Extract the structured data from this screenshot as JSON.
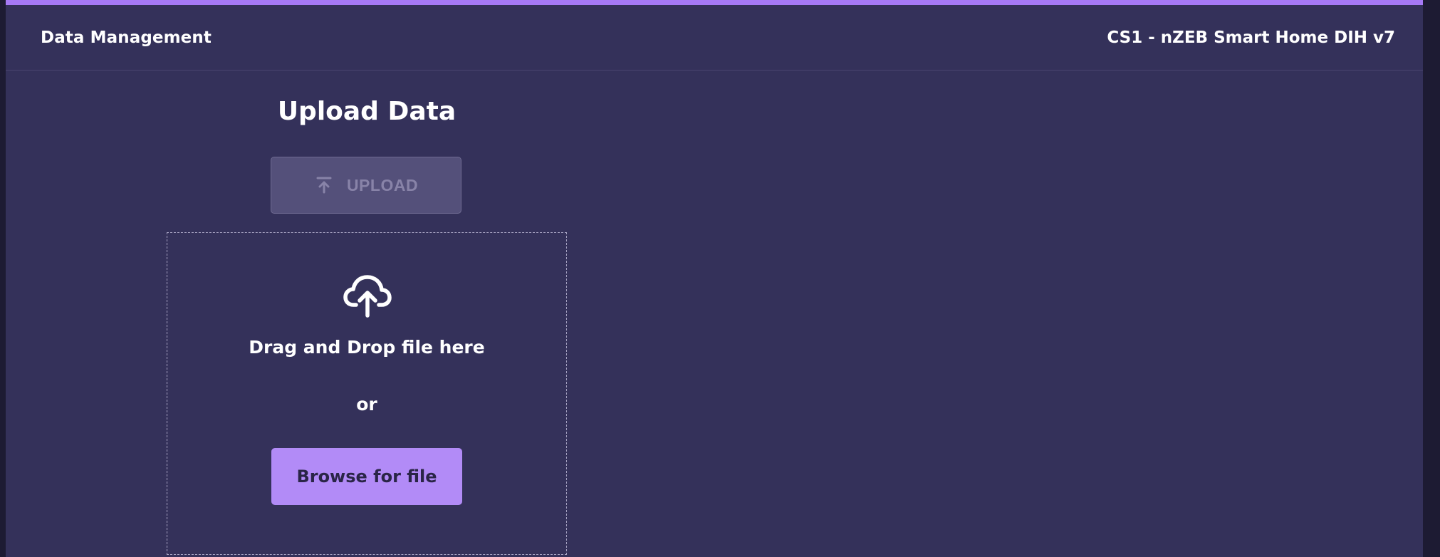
{
  "header": {
    "left_title": "Data Management",
    "right_title": "CS1 - nZEB Smart Home DIH v7"
  },
  "main": {
    "title": "Upload Data",
    "upload_button": {
      "label": "UPLOAD",
      "icon": "upload-icon",
      "state": "disabled"
    },
    "dropzone": {
      "icon": "cloud-upload-icon",
      "text": "Drag and Drop file here",
      "or_text": "or",
      "browse_label": "Browse for file"
    }
  },
  "colors": {
    "background": "#34315a",
    "accent": "#a679f6",
    "browse_button": "#b28bf7",
    "upload_button_disabled": "#54507a",
    "page_edge": "#1d1b33"
  }
}
